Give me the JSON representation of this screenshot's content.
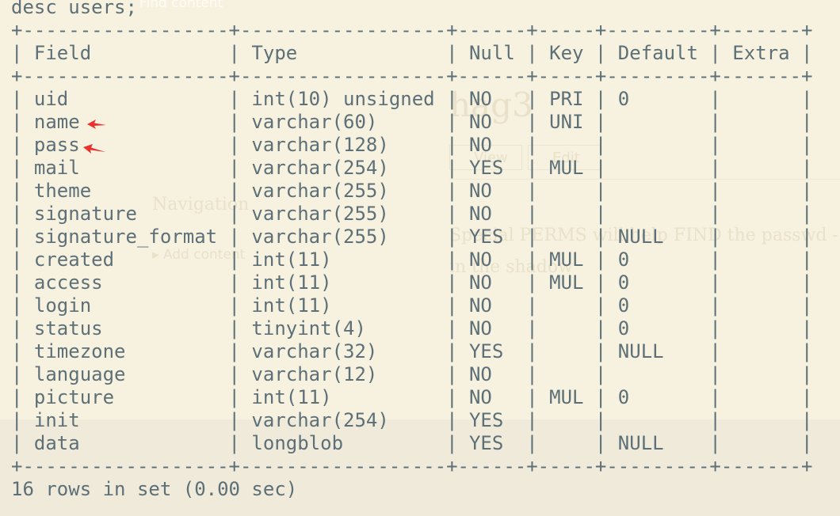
{
  "background_text": {
    "find_content": "Find content",
    "title": "hag3",
    "view": "View",
    "edit": "Edit",
    "navigation": "Navigation",
    "add_content": "Add content",
    "line1": "Special PERMS will help FIND the passwd - bu",
    "line2": "in the shadow"
  },
  "terminal": {
    "command": "desc users;",
    "border": "+------------------+------------------+------+-----+---------+-------+",
    "columns": [
      "Field",
      "Type",
      "Null",
      "Key",
      "Default",
      "Extra"
    ],
    "rows": [
      {
        "field": "uid",
        "type": "int(10) unsigned",
        "null": "NO",
        "key": "PRI",
        "default": "0",
        "extra": ""
      },
      {
        "field": "name",
        "type": "varchar(60)",
        "null": "NO",
        "key": "UNI",
        "default": "",
        "extra": ""
      },
      {
        "field": "pass",
        "type": "varchar(128)",
        "null": "NO",
        "key": "",
        "default": "",
        "extra": ""
      },
      {
        "field": "mail",
        "type": "varchar(254)",
        "null": "YES",
        "key": "MUL",
        "default": "",
        "extra": ""
      },
      {
        "field": "theme",
        "type": "varchar(255)",
        "null": "NO",
        "key": "",
        "default": "",
        "extra": ""
      },
      {
        "field": "signature",
        "type": "varchar(255)",
        "null": "NO",
        "key": "",
        "default": "",
        "extra": ""
      },
      {
        "field": "signature_format",
        "type": "varchar(255)",
        "null": "YES",
        "key": "",
        "default": "NULL",
        "extra": ""
      },
      {
        "field": "created",
        "type": "int(11)",
        "null": "NO",
        "key": "MUL",
        "default": "0",
        "extra": ""
      },
      {
        "field": "access",
        "type": "int(11)",
        "null": "NO",
        "key": "MUL",
        "default": "0",
        "extra": ""
      },
      {
        "field": "login",
        "type": "int(11)",
        "null": "NO",
        "key": "",
        "default": "0",
        "extra": ""
      },
      {
        "field": "status",
        "type": "tinyint(4)",
        "null": "NO",
        "key": "",
        "default": "0",
        "extra": ""
      },
      {
        "field": "timezone",
        "type": "varchar(32)",
        "null": "YES",
        "key": "",
        "default": "NULL",
        "extra": ""
      },
      {
        "field": "language",
        "type": "varchar(12)",
        "null": "NO",
        "key": "",
        "default": "",
        "extra": ""
      },
      {
        "field": "picture",
        "type": "int(11)",
        "null": "NO",
        "key": "MUL",
        "default": "0",
        "extra": ""
      },
      {
        "field": "init",
        "type": "varchar(254)",
        "null": "YES",
        "key": "",
        "default": "",
        "extra": ""
      },
      {
        "field": "data",
        "type": "longblob",
        "null": "YES",
        "key": "",
        "default": "NULL",
        "extra": ""
      }
    ],
    "footer": "16 rows in set (0.00 sec)"
  },
  "colors": {
    "text": "#5d7077",
    "background": "#f7f1df",
    "annotation_arrow": "#e8322b"
  },
  "annotations": [
    "red-arrow-icon",
    "red-arrow-icon"
  ]
}
